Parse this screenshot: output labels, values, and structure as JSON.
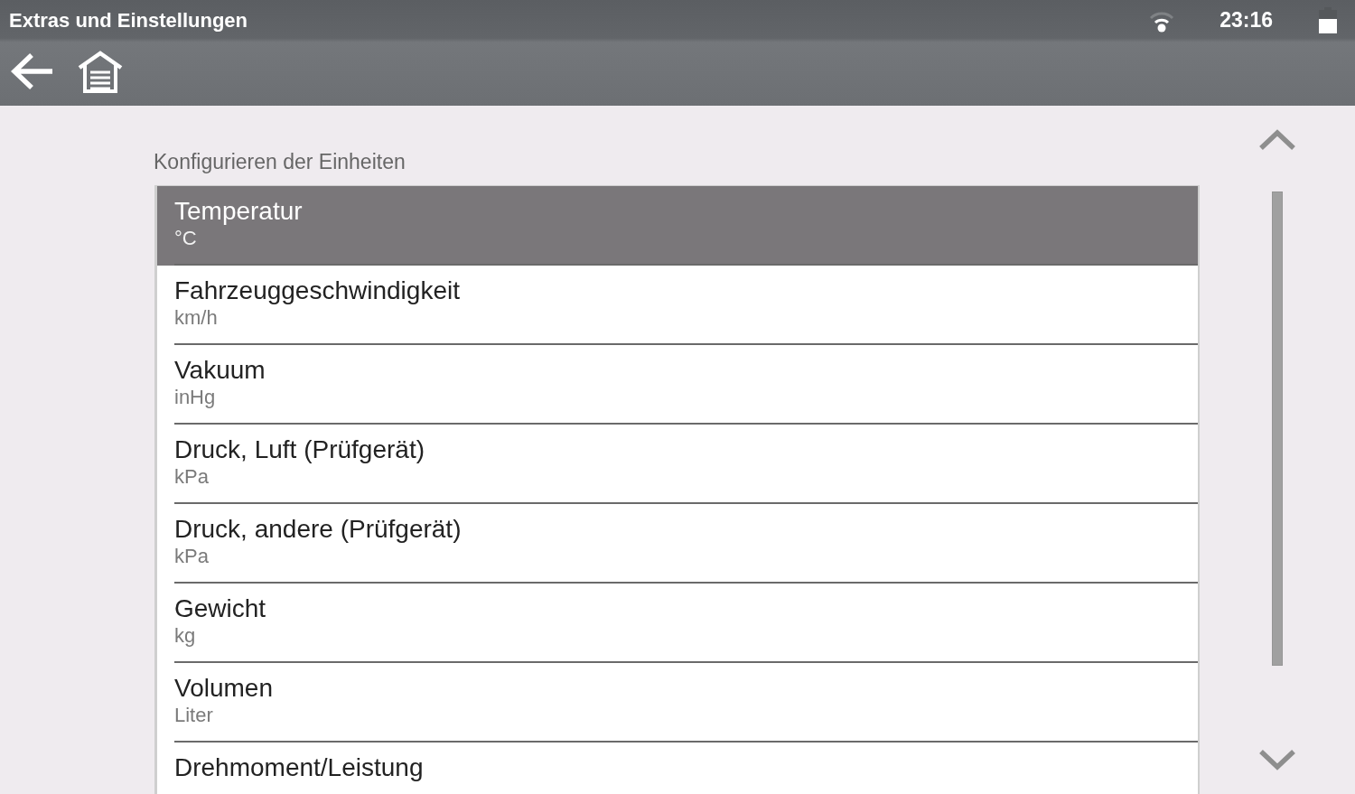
{
  "status_bar": {
    "title": "Extras und Einstellungen",
    "time": "23:16"
  },
  "section": {
    "label": "Konfigurieren der Einheiten"
  },
  "units": [
    {
      "name": "Temperatur",
      "unit": "°C",
      "selected": true
    },
    {
      "name": "Fahrzeuggeschwindigkeit",
      "unit": "km/h",
      "selected": false
    },
    {
      "name": "Vakuum",
      "unit": "inHg",
      "selected": false
    },
    {
      "name": "Druck, Luft (Prüfgerät)",
      "unit": "kPa",
      "selected": false
    },
    {
      "name": "Druck, andere (Prüfgerät)",
      "unit": "kPa",
      "selected": false
    },
    {
      "name": "Gewicht",
      "unit": "kg",
      "selected": false
    },
    {
      "name": "Volumen",
      "unit": "Liter",
      "selected": false
    },
    {
      "name": "Drehmoment/Leistung",
      "selected": false
    }
  ]
}
